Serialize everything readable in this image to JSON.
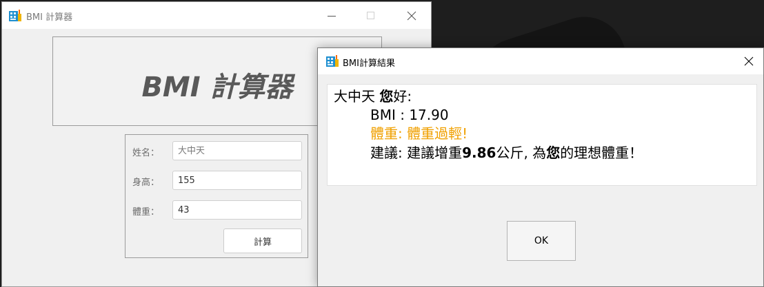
{
  "main_window": {
    "title": "BMI 計算器",
    "banner_title": "BMI 計算器",
    "form": {
      "name_label": "姓名：",
      "name_placeholder": "大中天",
      "height_label": "身高：",
      "height_value": "155",
      "weight_label": "體重：",
      "weight_value": "43",
      "calc_button_label": "計算"
    }
  },
  "result_dialog": {
    "title": "BMI計算結果",
    "greeting_name": "大中天 ",
    "greeting_you": "您",
    "greeting_suffix": "好:",
    "bmi_line": "BMI : 17.90",
    "weight_status_line": "體重: 體重過輕!",
    "advice_prefix": "建議: 建議增重",
    "advice_amount": "9.86",
    "advice_mid": "公斤, 為",
    "advice_you": "您",
    "advice_suffix": "的理想體重！",
    "ok_button_label": "OK"
  },
  "colors": {
    "warning_text": "#f0a000",
    "banner_text": "#595959"
  },
  "icons": {
    "app_icon": "calculator-app-icon",
    "minimize": "minimize-icon",
    "maximize": "maximize-icon",
    "close": "close-icon"
  }
}
